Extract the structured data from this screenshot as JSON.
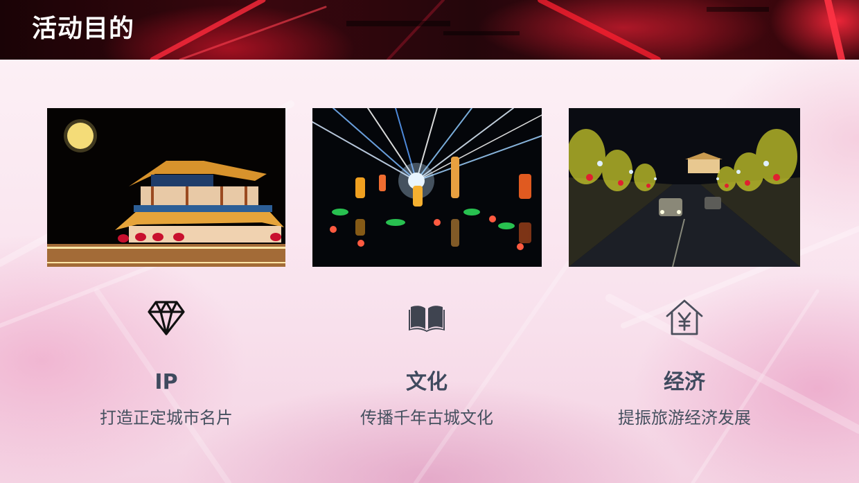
{
  "header": {
    "title": "活动目的"
  },
  "colors": {
    "header_bg": "#2a0409",
    "title_text": "#ffffff",
    "item_title": "#3f4a5e",
    "item_desc": "#45505f"
  },
  "photos": [
    {
      "subject": "night-lit ancient city gate tower with full moon"
    },
    {
      "subject": "lantern festival light show with spotlight beams"
    },
    {
      "subject": "street lined with lanterns and illuminated trees at night"
    }
  ],
  "items": [
    {
      "icon": "diamond-icon",
      "title": "IP",
      "desc": "打造正定城市名片"
    },
    {
      "icon": "book-icon",
      "title": "文化",
      "desc": "传播千年古城文化"
    },
    {
      "icon": "yuan-house-icon",
      "title": "经济",
      "desc": "提振旅游经济发展"
    }
  ]
}
